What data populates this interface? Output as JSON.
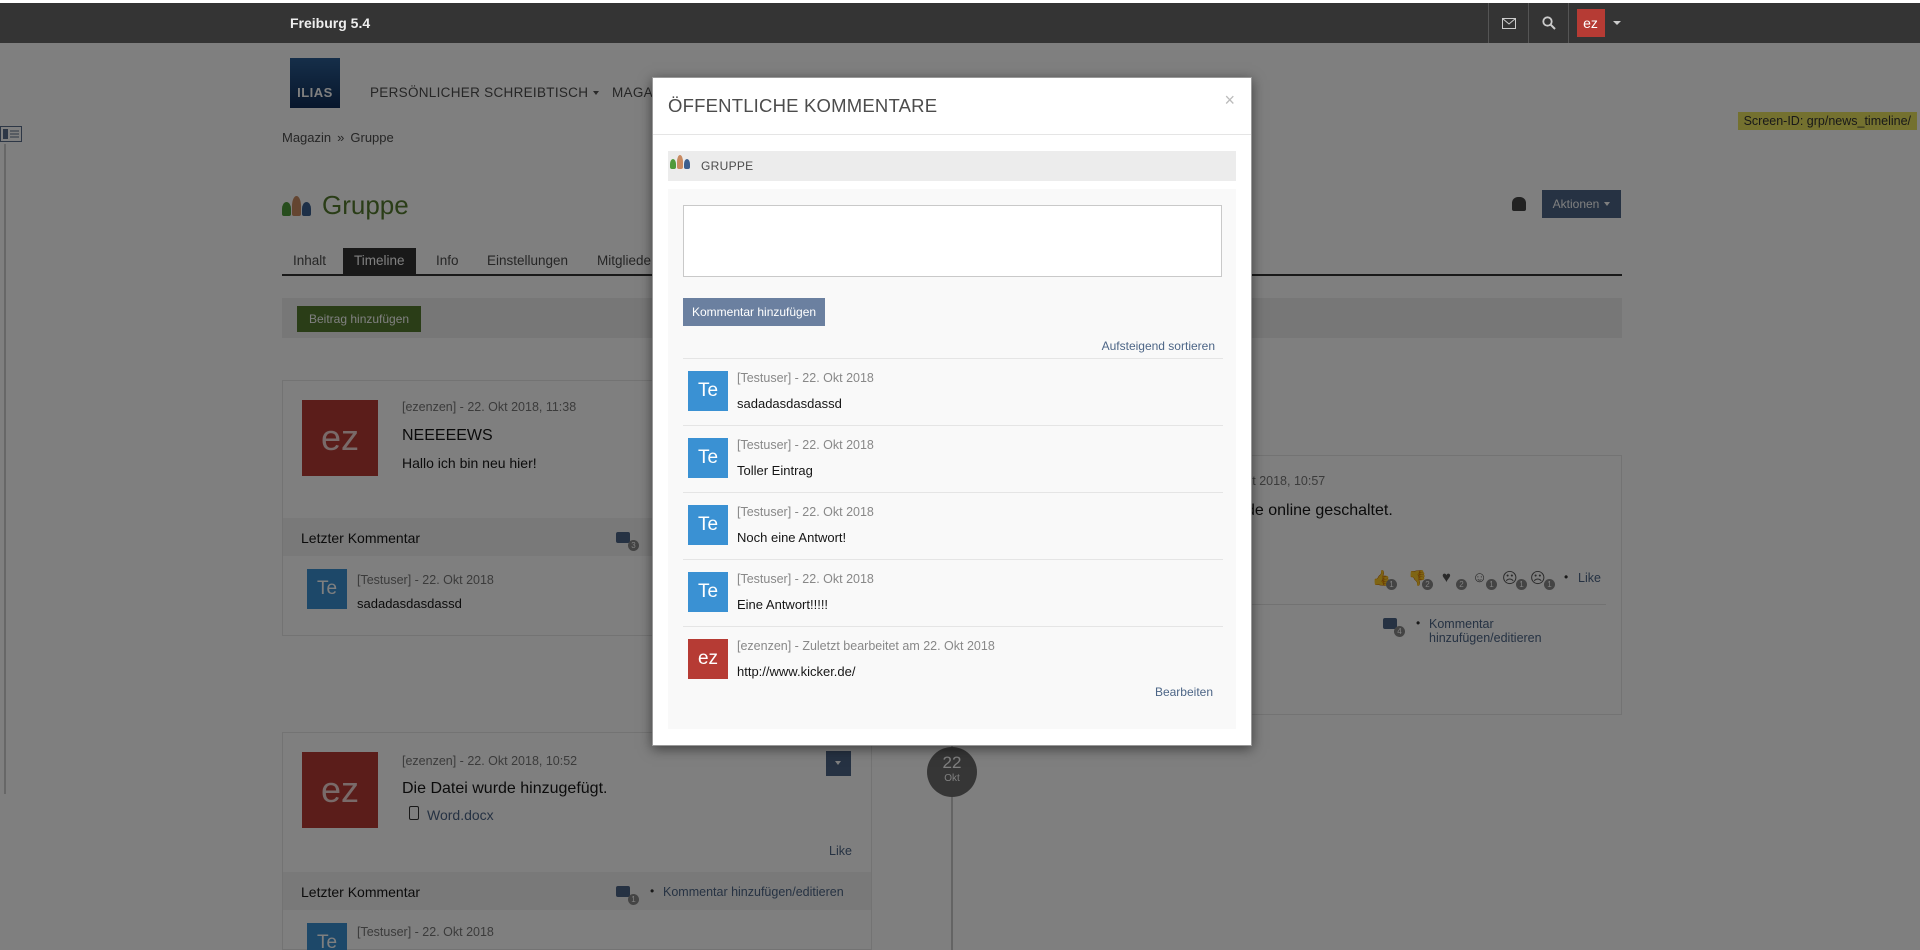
{
  "topbar": {
    "brand": "Freiburg 5.4",
    "user_initials": "ez"
  },
  "logo": {
    "text": "ILIAS"
  },
  "main_nav": {
    "item1": "PERSÖNLICHER SCHREIBTISCH",
    "item2": "MAGA"
  },
  "screen_id": "Screen-ID: grp/news_timeline/",
  "breadcrumb": {
    "item1": "Magazin",
    "separator": "»",
    "item2": "Gruppe"
  },
  "page": {
    "title": "Gruppe",
    "actions_label": "Aktionen"
  },
  "tabs": [
    {
      "label": "Inhalt",
      "active": false
    },
    {
      "label": "Timeline",
      "active": true
    },
    {
      "label": "Info",
      "active": false
    },
    {
      "label": "Einstellungen",
      "active": false
    },
    {
      "label": "Mitgliede",
      "active": false
    }
  ],
  "toolbar": {
    "add_post_label": "Beitrag hinzufügen"
  },
  "timeline": {
    "post1": {
      "avatar": "ez",
      "meta": "[ezenzen] - 22. Okt 2018, 11:38",
      "headline": "NEEEEEWS",
      "text": "Hallo ich bin neu hier!",
      "last_comment_label": "Letzter Kommentar",
      "comment_count": "3",
      "last_comment": {
        "avatar": "Te",
        "meta": "[Testuser] - 22. Okt 2018",
        "text": "sadadasdasdassd"
      }
    },
    "post2": {
      "avatar": "ez",
      "meta": "[ezenzen] - 22. Okt 2018, 10:52",
      "headline": "Die Datei wurde hinzugefügt.",
      "file": "Word.docx",
      "like_label": "Like",
      "last_comment_label": "Letzter Kommentar",
      "comment_count": "1",
      "add_comment_label": "Kommentar hinzufügen/editieren",
      "last_comment": {
        "avatar": "Te",
        "meta": "[Testuser] - 22. Okt 2018"
      }
    },
    "right_post": {
      "meta": "kt 2018, 10:57",
      "text": "de online geschaltet.",
      "reactions": [
        {
          "icon": "thumbs-up-icon",
          "count": "1"
        },
        {
          "icon": "thumbs-down-icon",
          "count": "2"
        },
        {
          "icon": "heart-icon",
          "count": "2"
        },
        {
          "icon": "laugh-icon",
          "count": "1"
        },
        {
          "icon": "surprised-icon",
          "count": "1"
        },
        {
          "icon": "sad-icon",
          "count": "1"
        }
      ],
      "like_label": "Like",
      "comment_count": "4",
      "add_comment_label": "Kommentar hinzufügen/editieren"
    },
    "date_marker": {
      "day": "22",
      "month": "Okt"
    }
  },
  "modal": {
    "title": "ÖFFENTLICHE KOMMENTARE",
    "close": "×",
    "context_label": "GRUPPE",
    "textarea_value": "",
    "add_button": "Kommentar hinzufügen",
    "sort_link": "Aufsteigend sortieren",
    "comments": [
      {
        "avatar": "Te",
        "avatar_color": "#3a91d3",
        "meta": "[Testuser] - 22. Okt 2018",
        "text": "sadadasdasdassd"
      },
      {
        "avatar": "Te",
        "avatar_color": "#3a91d3",
        "meta": "[Testuser] - 22. Okt 2018",
        "text": "Toller Eintrag"
      },
      {
        "avatar": "Te",
        "avatar_color": "#3a91d3",
        "meta": "[Testuser] - 22. Okt 2018",
        "text": "Noch eine Antwort!"
      },
      {
        "avatar": "Te",
        "avatar_color": "#3a91d3",
        "meta": "[Testuser] - 22. Okt 2018",
        "text": "Eine Antwort!!!!!"
      },
      {
        "avatar": "ez",
        "avatar_color": "#b63b34",
        "meta": "[ezenzen] - Zuletzt bearbeitet am 22. Okt 2018",
        "text": "http://www.kicker.de/"
      }
    ],
    "edit_link": "Bearbeiten"
  },
  "colors": {
    "accent": "#4c6586",
    "green": "#557b2e",
    "topbar": "#343434",
    "user_avatar": "#b63b34",
    "test_avatar": "#3a91d3"
  }
}
